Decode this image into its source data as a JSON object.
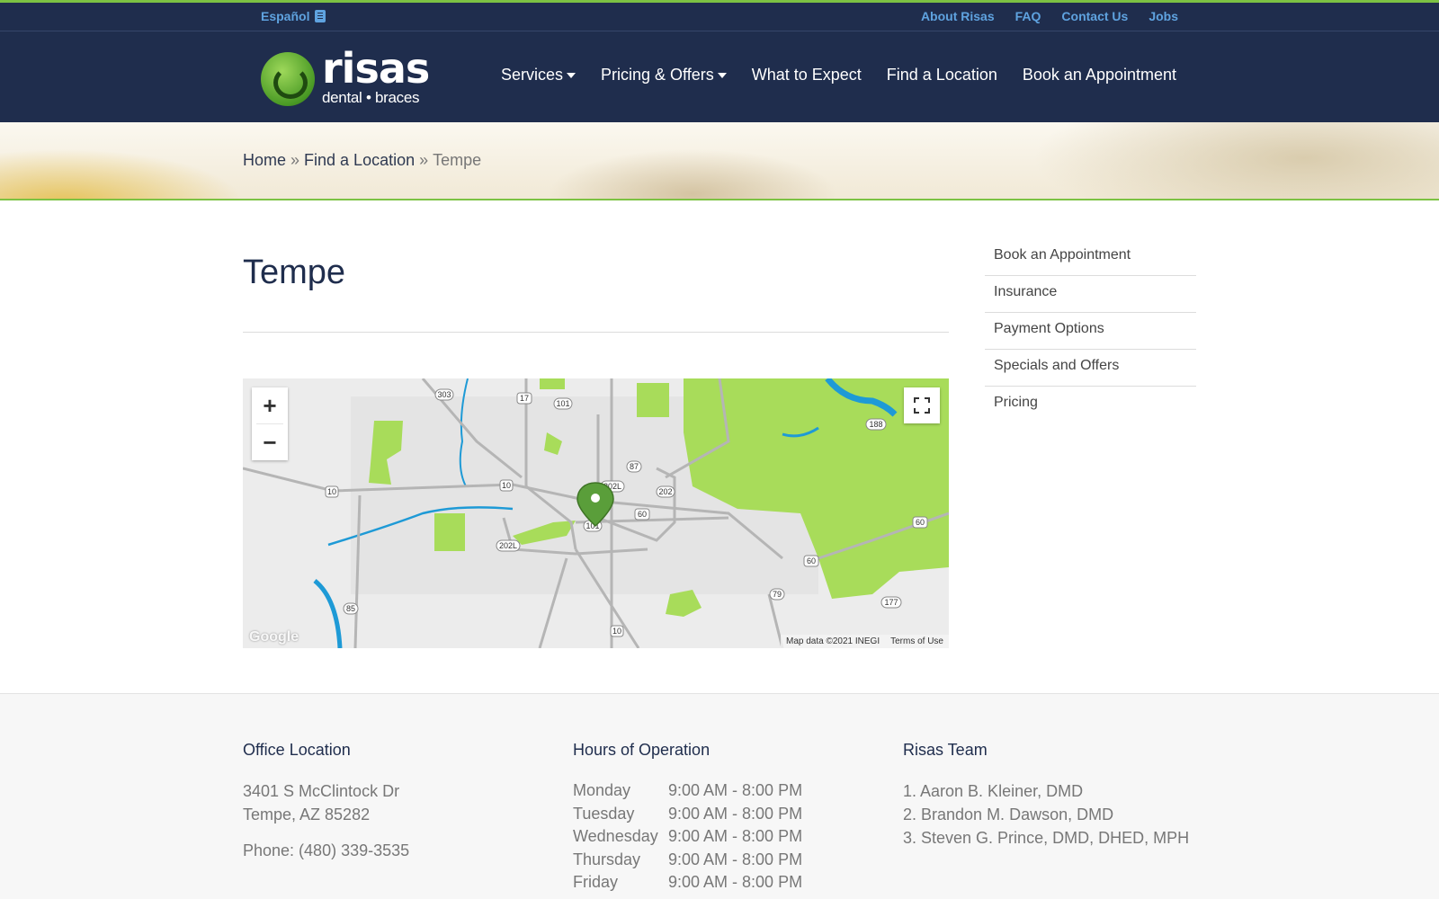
{
  "topbar": {
    "language": "Español",
    "links": [
      "About Risas",
      "FAQ",
      "Contact Us",
      "Jobs"
    ]
  },
  "logo": {
    "word": "risas",
    "sub": "dental • braces"
  },
  "nav": {
    "items": [
      {
        "label": "Services",
        "dropdown": true
      },
      {
        "label": "Pricing & Offers",
        "dropdown": true
      },
      {
        "label": "What to Expect",
        "dropdown": false
      },
      {
        "label": "Find a Location",
        "dropdown": false
      },
      {
        "label": "Book an Appointment",
        "dropdown": false
      }
    ]
  },
  "breadcrumb": {
    "home": "Home",
    "sep": "»",
    "parent": "Find a Location",
    "current": "Tempe"
  },
  "page": {
    "title": "Tempe"
  },
  "map": {
    "zoom_in": "+",
    "zoom_out": "−",
    "google": "Google",
    "attribution": "Map data ©2021 INEGI",
    "terms": "Terms of Use",
    "shields": [
      "303",
      "17",
      "101",
      "87",
      "202L",
      "202",
      "10",
      "10",
      "60",
      "101",
      "202L",
      "85",
      "10",
      "79",
      "60",
      "60",
      "177",
      "188"
    ]
  },
  "sidebar": {
    "items": [
      "Book an Appointment",
      "Insurance",
      "Payment Options",
      "Specials and Offers",
      "Pricing"
    ]
  },
  "footer": {
    "office": {
      "heading": "Office Location",
      "address1": "3401 S McClintock Dr",
      "address2": "Tempe, AZ 85282",
      "phone": "Phone: (480) 339-3535"
    },
    "hours": {
      "heading": "Hours of Operation",
      "rows": [
        {
          "day": "Monday",
          "time": "9:00 AM - 8:00 PM"
        },
        {
          "day": "Tuesday",
          "time": "9:00 AM - 8:00 PM"
        },
        {
          "day": "Wednesday",
          "time": "9:00 AM - 8:00 PM"
        },
        {
          "day": "Thursday",
          "time": "9:00 AM - 8:00 PM"
        },
        {
          "day": "Friday",
          "time": "9:00 AM - 8:00 PM"
        }
      ]
    },
    "team": {
      "heading": "Risas Team",
      "members": [
        "1. Aaron B. Kleiner, DMD",
        "2. Brandon M. Dawson, DMD",
        "3. Steven G. Prince, DMD, DHED, MPH"
      ]
    }
  },
  "colors": {
    "navy": "#1f2d4d",
    "accent_green": "#7cc243",
    "link_blue": "#5fa3e0",
    "map_park": "#a8dc5a",
    "map_water": "#1e9ad6"
  }
}
